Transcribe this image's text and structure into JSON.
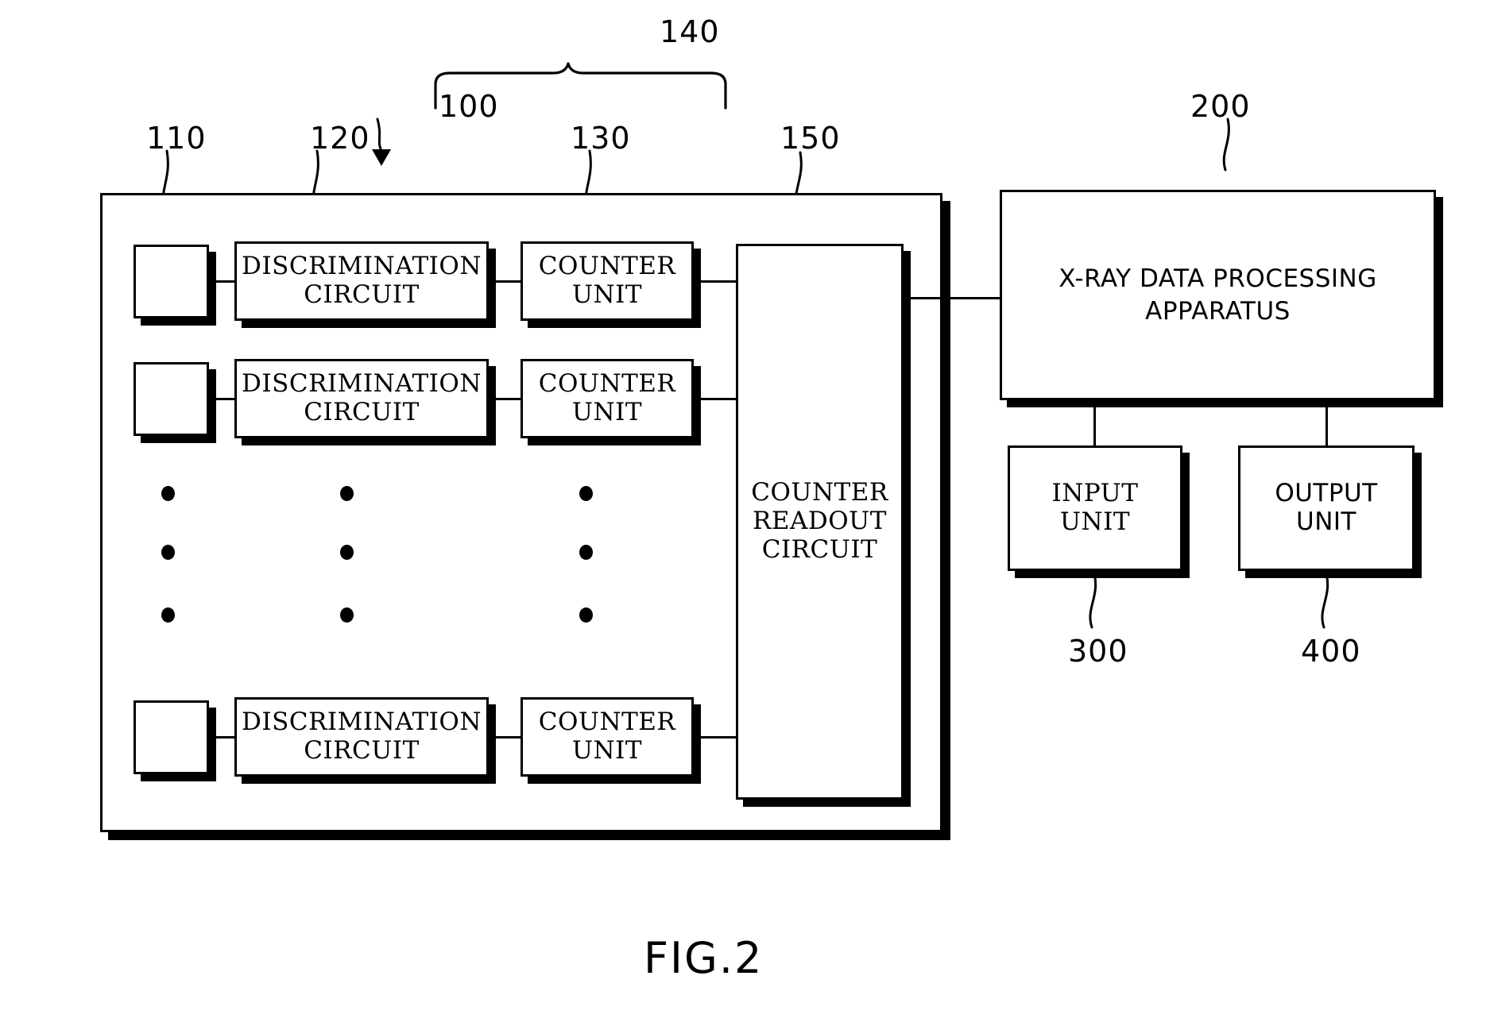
{
  "figure": {
    "caption": "FIG.2",
    "type": "patent-block-diagram"
  },
  "reference_numerals": {
    "detector_element": "110",
    "discrimination_circuit": "120",
    "system_assembly": "100",
    "counter_unit": "130",
    "signal_processing_group": "140",
    "counter_readout_circuit": "150",
    "xray_data_processing_apparatus": "200",
    "input_unit": "300",
    "output_unit": "400"
  },
  "detector_module": {
    "label_100": "100",
    "label_110": "110",
    "label_120": "120",
    "label_130": "130",
    "label_140": "140",
    "label_150": "150",
    "rows": [
      {
        "detector": "",
        "discrimination_circuit": "DISCRIMINATION\nCIRCUIT",
        "discrimination_line1": "DISCRIMINATION",
        "discrimination_line2": "CIRCUIT",
        "counter_line1": "COUNTER",
        "counter_line2": "UNIT"
      },
      {
        "detector": "",
        "discrimination_circuit": "DISCRIMINATION\nCIRCUIT",
        "discrimination_line1": "DISCRIMINATION",
        "discrimination_line2": "CIRCUIT",
        "counter_line1": "COUNTER",
        "counter_line2": "UNIT"
      },
      {
        "detector": "",
        "discrimination_circuit": "DISCRIMINATION\nCIRCUIT",
        "discrimination_line1": "DISCRIMINATION",
        "discrimination_line2": "CIRCUIT",
        "counter_line1": "COUNTER",
        "counter_line2": "UNIT"
      }
    ],
    "readout": {
      "line1": "COUNTER",
      "line2": "READOUT",
      "line3": "CIRCUIT"
    }
  },
  "processing_side": {
    "apparatus": {
      "line1": "X-RAY DATA PROCESSING",
      "line2": "APPARATUS",
      "label": "200"
    },
    "input_unit": {
      "line1": "INPUT",
      "line2": "UNIT",
      "label": "300"
    },
    "output_unit": {
      "line1": "OUTPUT",
      "line2": "UNIT",
      "label": "400"
    }
  },
  "colors": {
    "ink": "#000000",
    "paper": "#ffffff"
  }
}
